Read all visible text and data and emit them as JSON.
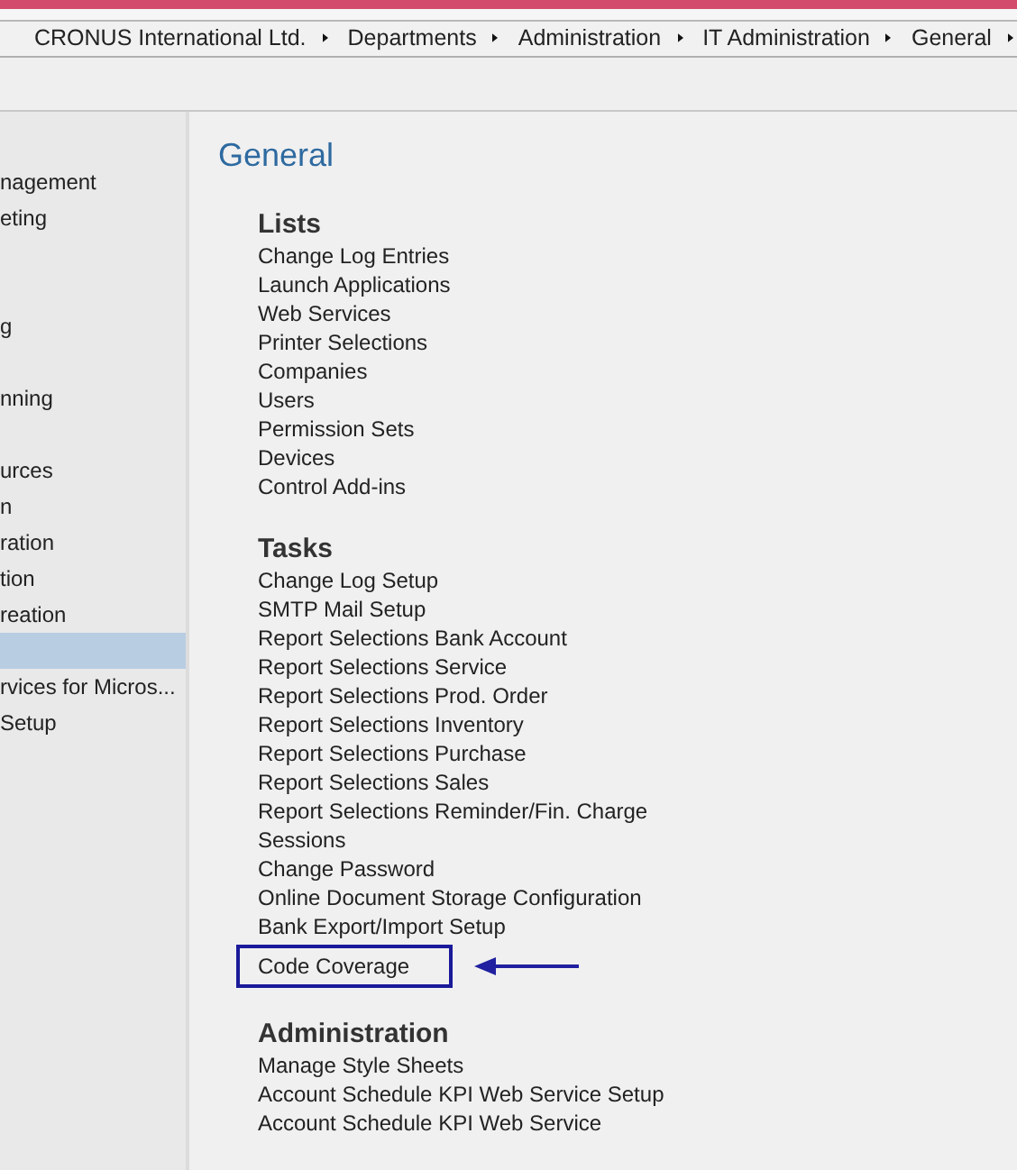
{
  "breadcrumb": [
    "CRONUS International Ltd.",
    "Departments",
    "Administration",
    "IT Administration",
    "General"
  ],
  "sidebar": {
    "items": [
      {
        "label": "nagement",
        "selected": false
      },
      {
        "label": "eting",
        "selected": false
      },
      {
        "selected": false
      },
      {
        "selected": false
      },
      {
        "label": "g",
        "selected": false
      },
      {
        "selected": false
      },
      {
        "label": "nning",
        "selected": false
      },
      {
        "selected": false
      },
      {
        "label": "urces",
        "selected": false
      },
      {
        "label": "n",
        "selected": false
      },
      {
        "label": "ration",
        "selected": false
      },
      {
        "label": "tion",
        "selected": false
      },
      {
        "label": "reation",
        "selected": false
      },
      {
        "selected": true
      },
      {
        "label": "rvices for Micros...",
        "selected": false
      },
      {
        "label": "Setup",
        "selected": false
      }
    ]
  },
  "page": {
    "title": "General",
    "sections": [
      {
        "heading": "Lists",
        "items": [
          {
            "label": "Change Log Entries",
            "highlighted": false
          },
          {
            "label": "Launch Applications",
            "highlighted": false
          },
          {
            "label": "Web Services",
            "highlighted": false
          },
          {
            "label": "Printer Selections",
            "highlighted": false
          },
          {
            "label": "Companies",
            "highlighted": false
          },
          {
            "label": "Users",
            "highlighted": false
          },
          {
            "label": "Permission Sets",
            "highlighted": false
          },
          {
            "label": "Devices",
            "highlighted": false
          },
          {
            "label": "Control Add-ins",
            "highlighted": false
          }
        ]
      },
      {
        "heading": "Tasks",
        "items": [
          {
            "label": "Change Log Setup",
            "highlighted": false
          },
          {
            "label": "SMTP Mail Setup",
            "highlighted": false
          },
          {
            "label": "Report Selections Bank Account",
            "highlighted": false
          },
          {
            "label": "Report Selections Service",
            "highlighted": false
          },
          {
            "label": "Report Selections Prod. Order",
            "highlighted": false
          },
          {
            "label": "Report Selections Inventory",
            "highlighted": false
          },
          {
            "label": "Report Selections Purchase",
            "highlighted": false
          },
          {
            "label": "Report Selections Sales",
            "highlighted": false
          },
          {
            "label": "Report Selections Reminder/Fin. Charge",
            "highlighted": false
          },
          {
            "label": "Sessions",
            "highlighted": false
          },
          {
            "label": "Change Password",
            "highlighted": false
          },
          {
            "label": "Online Document Storage Configuration",
            "highlighted": false
          },
          {
            "label": "Bank Export/Import Setup",
            "highlighted": false
          },
          {
            "label": "Code Coverage",
            "highlighted": true
          }
        ]
      },
      {
        "heading": "Administration",
        "items": [
          {
            "label": "Manage Style Sheets",
            "highlighted": false
          },
          {
            "label": "Account Schedule KPI Web Service Setup",
            "highlighted": false
          },
          {
            "label": "Account Schedule KPI Web Service",
            "highlighted": false
          }
        ]
      }
    ]
  }
}
